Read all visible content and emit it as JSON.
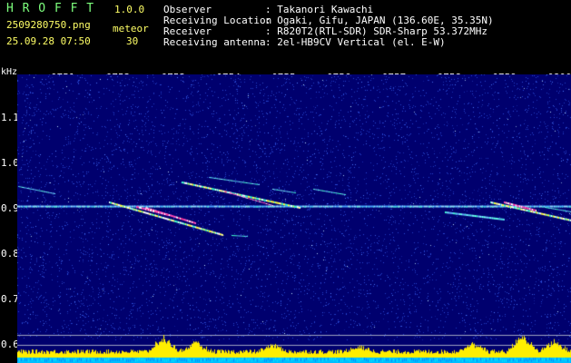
{
  "header": {
    "app_name": "H R O F F T",
    "version": "1.0.0",
    "filename": "2509280750.png",
    "timestamp": "25.09.28 07:50",
    "meteor_label": "meteor",
    "meteor_count": "30",
    "info_lines": [
      {
        "key": "Observer",
        "value": ": Takanori Kawachi"
      },
      {
        "key": "Receiving Location",
        "value": ": Ogaki, Gifu, JAPAN (136.60E, 35.35N)"
      },
      {
        "key": "Receiver",
        "value": ": R820T2(RTL-SDR) SDR-Sharp 53.372MHz"
      },
      {
        "key": "Receiving antenna",
        "value": ": 2el-HB9CV Vertical (el. E-W)"
      }
    ]
  },
  "spectrogram": {
    "y_unit": "kHz",
    "y_ticks": [
      "1.1",
      "1.0",
      "0.9",
      "0.8",
      "0.7",
      "0.6"
    ],
    "x_ticks": [
      "0751",
      "0752",
      "0753",
      "0754",
      "0755",
      "0756",
      "0757",
      "0758",
      "0759",
      "0800"
    ],
    "carrier_khz": 0.905,
    "colors": {
      "background": "#00006e",
      "noise": "#2a4bd6",
      "echo_hot": "#ff55c8",
      "echo_warm": "#ffff40",
      "echo_cool": "#40ffd0",
      "level_fill": "#ffee00",
      "level_base": "#00bfff"
    }
  }
}
